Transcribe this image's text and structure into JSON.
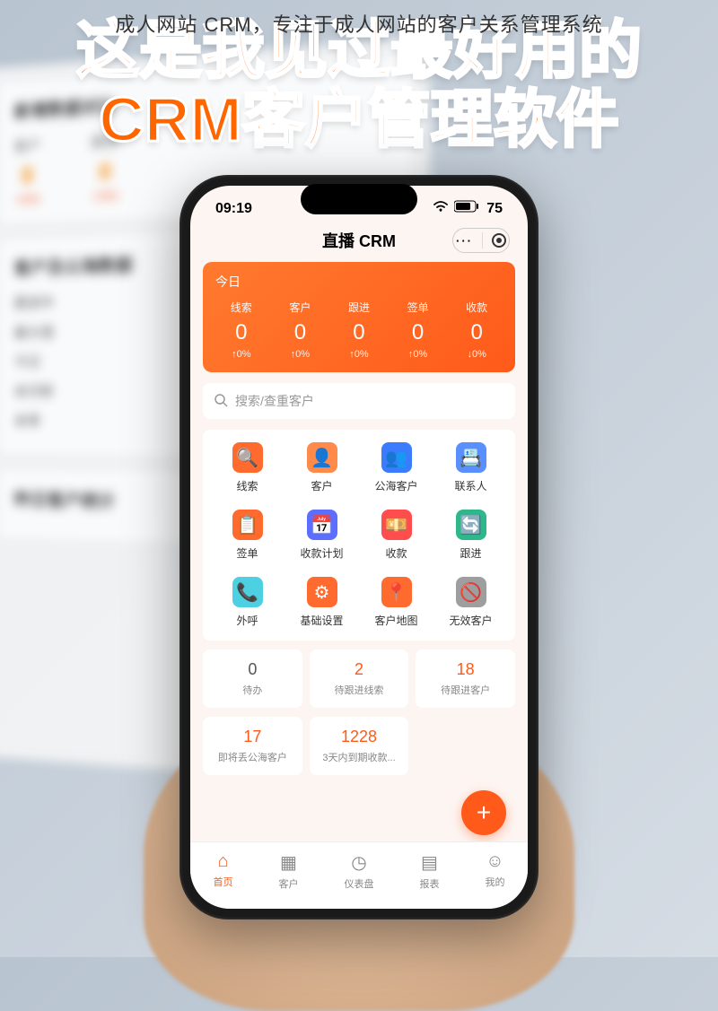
{
  "caption": "成人网站 CRM，专注于成人网站的客户关系管理系统",
  "headline_line1": "这是我见过最好用的",
  "headline_line2": "CRM客户管理软件",
  "bg_monitor": {
    "panel1_title": "新增数据对比",
    "stats": [
      {
        "label": "客户",
        "value": "0",
        "pct": "+0%"
      },
      {
        "label": "跟进",
        "value": "0",
        "pct": "+0%"
      }
    ],
    "panel2_title": "客户及公海数据",
    "panel2_items": [
      "跟进中",
      "最大值",
      "今日",
      "本月新",
      "本季"
    ],
    "panel3_title": "昨日客户统计"
  },
  "status": {
    "time": "09:19",
    "battery": "75"
  },
  "app_header": {
    "title": "直播 CRM",
    "more": "···"
  },
  "stats_card": {
    "today_label": "今日",
    "cols": [
      {
        "label": "线索",
        "value": "0",
        "change": "↑0%"
      },
      {
        "label": "客户",
        "value": "0",
        "change": "↑0%"
      },
      {
        "label": "跟进",
        "value": "0",
        "change": "↑0%"
      },
      {
        "label": "签单",
        "value": "0",
        "change": "↑0%"
      },
      {
        "label": "收款",
        "value": "0",
        "change": "↓0%"
      }
    ]
  },
  "search": {
    "placeholder": "搜索/查重客户"
  },
  "grid": [
    {
      "icon": "🔍",
      "bg": "#ff6b2e",
      "label": "线索"
    },
    {
      "icon": "👤",
      "bg": "#ff8a4a",
      "label": "客户"
    },
    {
      "icon": "👥",
      "bg": "#3b7cff",
      "label": "公海客户"
    },
    {
      "icon": "📇",
      "bg": "#5a8fff",
      "label": "联系人"
    },
    {
      "icon": "📋",
      "bg": "#ff6b2e",
      "label": "签单"
    },
    {
      "icon": "📅",
      "bg": "#5b6eff",
      "label": "收款计划"
    },
    {
      "icon": "💴",
      "bg": "#ff4d4d",
      "label": "收款"
    },
    {
      "icon": "🔄",
      "bg": "#2eb88a",
      "label": "跟进"
    },
    {
      "icon": "📞",
      "bg": "#4dd0e1",
      "label": "外呼"
    },
    {
      "icon": "⚙",
      "bg": "#ff6b2e",
      "label": "基础设置"
    },
    {
      "icon": "📍",
      "bg": "#ff6b2e",
      "label": "客户地图"
    },
    {
      "icon": "🚫",
      "bg": "#9e9e9e",
      "label": "无效客户"
    }
  ],
  "tasks_row1": [
    {
      "num": "0",
      "numClass": "gray",
      "label": "待办"
    },
    {
      "num": "2",
      "numClass": "orange",
      "label": "待跟进线索"
    },
    {
      "num": "18",
      "numClass": "orange",
      "label": "待跟进客户"
    }
  ],
  "tasks_row2": [
    {
      "num": "17",
      "numClass": "orange",
      "label": "即将丢公海客户"
    },
    {
      "num": "1228",
      "numClass": "orange",
      "label": "3天内到期收款..."
    }
  ],
  "fab": "+",
  "bottom_nav": [
    {
      "icon": "⌂",
      "label": "首页",
      "active": true
    },
    {
      "icon": "▦",
      "label": "客户",
      "active": false
    },
    {
      "icon": "◷",
      "label": "仪表盘",
      "active": false
    },
    {
      "icon": "▤",
      "label": "报表",
      "active": false
    },
    {
      "icon": "☺",
      "label": "我的",
      "active": false
    }
  ]
}
